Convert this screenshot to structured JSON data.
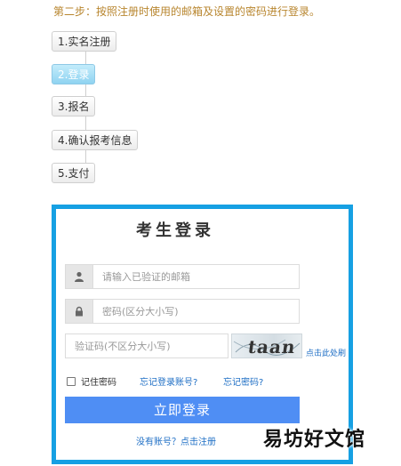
{
  "caption": "第二步：按照注册时使用的邮箱及设置的密码进行登录。",
  "steps": [
    {
      "label": "1.实名注册"
    },
    {
      "label": "2.登录"
    },
    {
      "label": "3.报名"
    },
    {
      "label": "4.确认报考信息"
    },
    {
      "label": "5.支付"
    }
  ],
  "login": {
    "title": "考生登录",
    "email_placeholder": "请输入已验证的邮箱",
    "password_placeholder": "密码(区分大小写)",
    "captcha_placeholder": "验证码(不区分大小写)",
    "captcha_text": "taan",
    "refresh_label": "点击此处刷",
    "remember_label": "记住密码",
    "forgot_account": "忘记登录账号?",
    "forgot_password": "忘记密码?",
    "submit_label": "立即登录",
    "register_label": "没有账号？点击注册"
  },
  "watermark": "易坊好文馆",
  "colors": {
    "panel_border": "#16a0e3",
    "button": "#4f8ef4",
    "active_step": "#8fd3f1",
    "link": "#1f6fc5"
  }
}
